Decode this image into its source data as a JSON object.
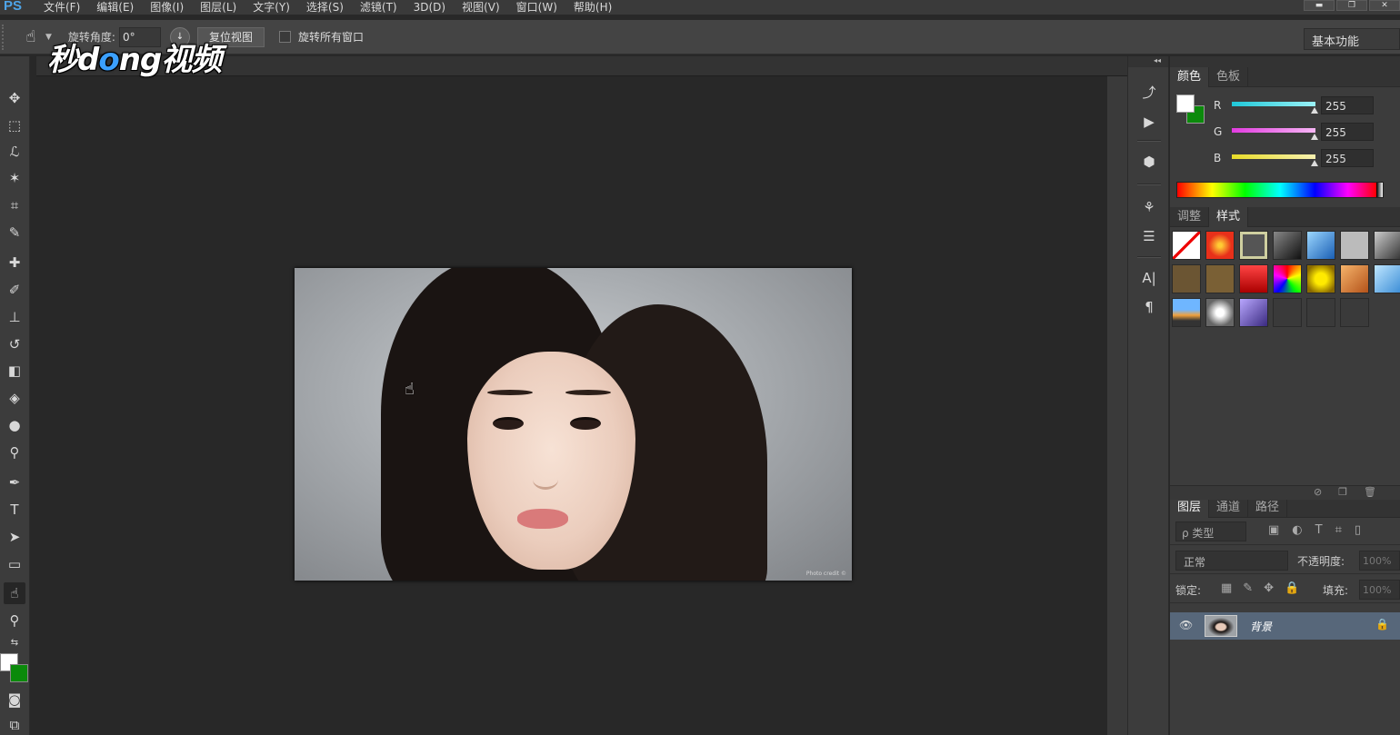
{
  "app": {
    "logo": "PS",
    "menu": [
      "文件(F)",
      "编辑(E)",
      "图像(I)",
      "图层(L)",
      "文字(Y)",
      "选择(S)",
      "滤镜(T)",
      "3D(D)",
      "视图(V)",
      "窗口(W)",
      "帮助(H)"
    ]
  },
  "options_bar": {
    "rotation_label": "旋转角度:",
    "rotation_value": "0°",
    "reset_view": "复位视图",
    "rotate_all_label": "旋转所有窗口",
    "workspace": "基本功能"
  },
  "watermark": {
    "part1": "秒d",
    "part2": "o",
    "part3": "ng视频"
  },
  "photo": {
    "caption": "Photo credit ©"
  },
  "color_panel": {
    "tabs": [
      "颜色",
      "色板"
    ],
    "channels": [
      {
        "name": "R",
        "value": "255",
        "color": "#36d5e6"
      },
      {
        "name": "G",
        "value": "255",
        "color": "#e23be0"
      },
      {
        "name": "B",
        "value": "255",
        "color": "#e8dc28"
      }
    ],
    "foreground": "#ffffff",
    "background": "#0b8a0b"
  },
  "styles_panel": {
    "tabs": [
      "调整",
      "样式"
    ]
  },
  "layers_panel": {
    "tabs": [
      "图层",
      "通道",
      "路径"
    ],
    "kind_filter": "ρ 类型",
    "blend_mode": "正常",
    "opacity_label": "不透明度:",
    "opacity_value": "100%",
    "lock_label": "锁定:",
    "fill_label": "填充:",
    "fill_value": "100%",
    "layers": [
      {
        "name": "背景",
        "locked": true
      }
    ]
  }
}
